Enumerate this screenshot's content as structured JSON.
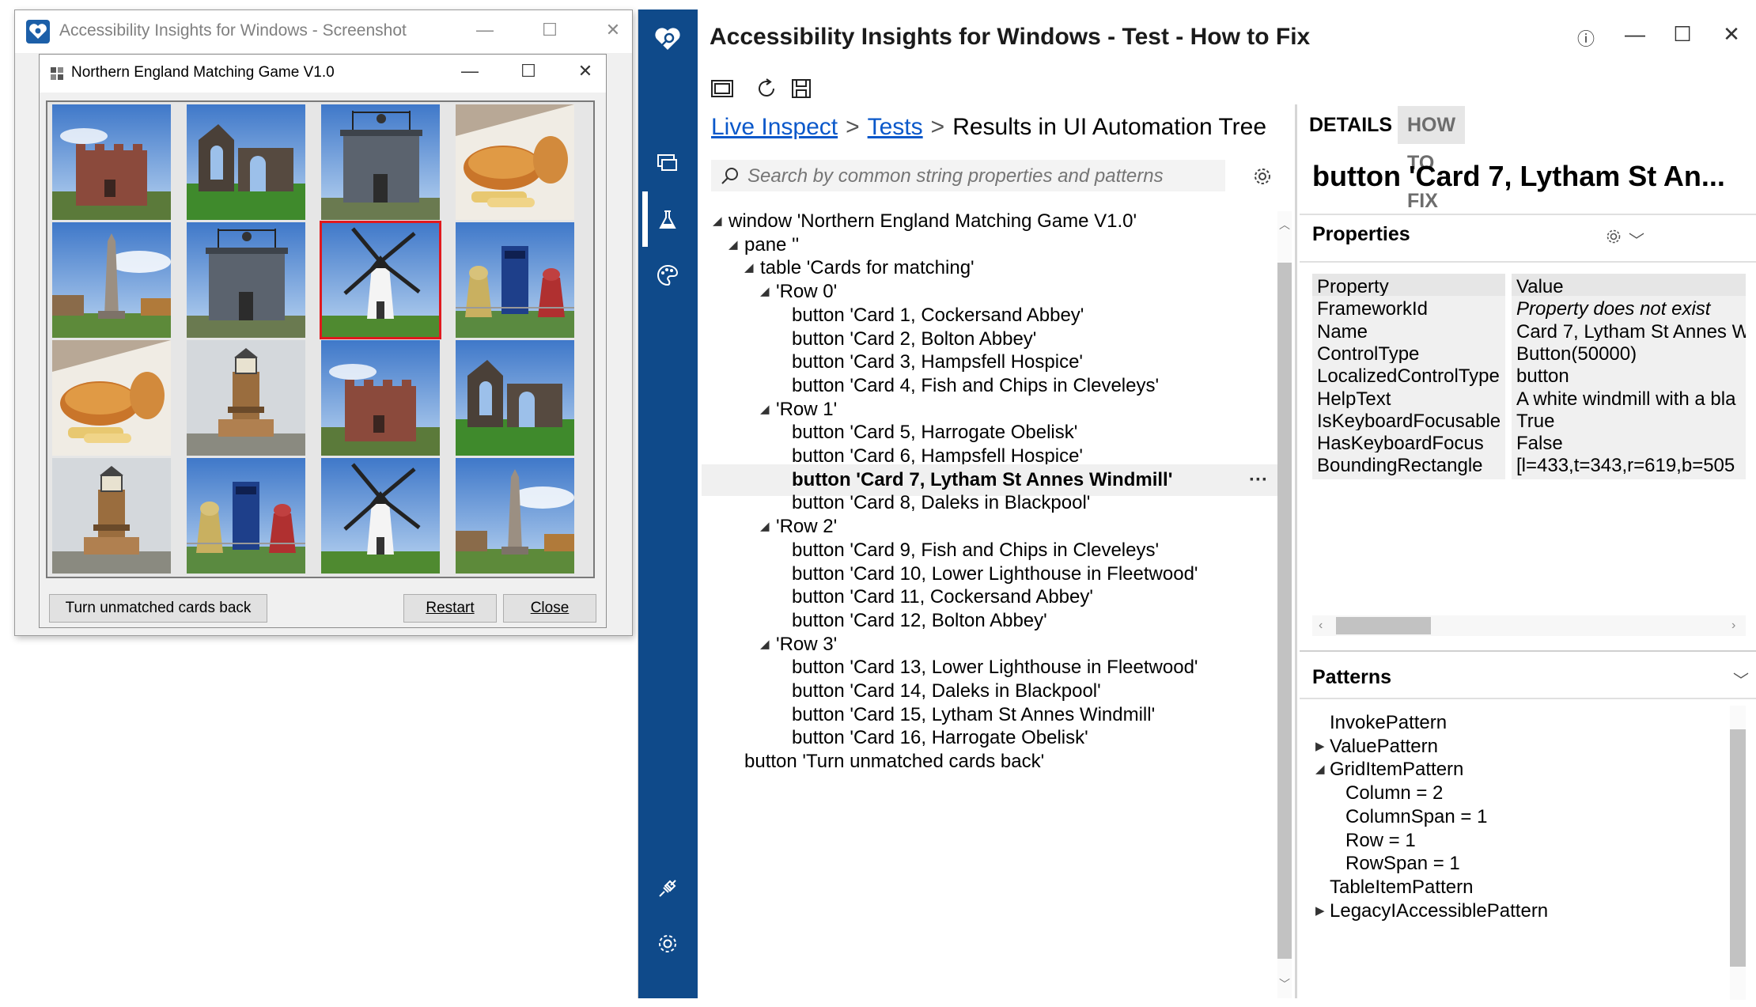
{
  "outer_window": {
    "title": "Accessibility Insights for Windows - Screenshot"
  },
  "game_window": {
    "title": "Northern England Matching Game V1.0",
    "cards": [
      {
        "subject": "fort"
      },
      {
        "subject": "abbey-ruin"
      },
      {
        "subject": "stone-tower"
      },
      {
        "subject": "fish-and-chips"
      },
      {
        "subject": "obelisk"
      },
      {
        "subject": "stone-tower"
      },
      {
        "subject": "windmill",
        "selected": true
      },
      {
        "subject": "daleks"
      },
      {
        "subject": "fish-and-chips"
      },
      {
        "subject": "lighthouse"
      },
      {
        "subject": "fort"
      },
      {
        "subject": "abbey-ruin"
      },
      {
        "subject": "lighthouse"
      },
      {
        "subject": "daleks"
      },
      {
        "subject": "windmill"
      },
      {
        "subject": "obelisk"
      }
    ],
    "buttons": {
      "turn_unmatched": "Turn unmatched cards back",
      "restart": "Restart",
      "close": "Close"
    }
  },
  "ai": {
    "title": "Accessibility Insights for Windows - Test - How to Fix",
    "breadcrumb": {
      "link1": "Live Inspect",
      "link2": "Tests",
      "current": "Results in UI Automation Tree"
    },
    "search": {
      "placeholder": "Search by common string properties and patterns"
    },
    "tree": [
      {
        "text": "window 'Northern England Matching Game V1.0'",
        "exp": "◢"
      },
      {
        "text": "pane ''",
        "exp": "◢"
      },
      {
        "text": "table 'Cards for matching'",
        "exp": "◢"
      },
      {
        "text": "'Row 0'",
        "exp": "◢"
      },
      {
        "text": "button 'Card 1, Cockersand Abbey'",
        "exp": ""
      },
      {
        "text": "button 'Card 2, Bolton Abbey'",
        "exp": ""
      },
      {
        "text": "button 'Card 3, Hampsfell Hospice'",
        "exp": ""
      },
      {
        "text": "button 'Card 4, Fish and Chips in Cleveleys'",
        "exp": ""
      },
      {
        "text": "'Row 1'",
        "exp": "◢"
      },
      {
        "text": "button 'Card 5, Harrogate Obelisk'",
        "exp": ""
      },
      {
        "text": "button 'Card 6, Hampsfell Hospice'",
        "exp": ""
      },
      {
        "text": "button 'Card 7, Lytham St Annes Windmill'",
        "exp": "",
        "selected": true
      },
      {
        "text": "button 'Card 8, Daleks in Blackpool'",
        "exp": ""
      },
      {
        "text": "'Row 2'",
        "exp": "◢"
      },
      {
        "text": "button 'Card 9, Fish and Chips in Cleveleys'",
        "exp": ""
      },
      {
        "text": "button 'Card 10, Lower Lighthouse in Fleetwood'",
        "exp": ""
      },
      {
        "text": "button 'Card 11, Cockersand Abbey'",
        "exp": ""
      },
      {
        "text": "button 'Card 12, Bolton Abbey'",
        "exp": ""
      },
      {
        "text": "'Row 3'",
        "exp": "◢"
      },
      {
        "text": "button 'Card 13, Lower Lighthouse in Fleetwood'",
        "exp": ""
      },
      {
        "text": "button 'Card 14, Daleks in Blackpool'",
        "exp": ""
      },
      {
        "text": "button 'Card 15, Lytham St Annes Windmill'",
        "exp": ""
      },
      {
        "text": "button 'Card 16, Harrogate Obelisk'",
        "exp": ""
      },
      {
        "text": "button 'Turn unmatched cards back'",
        "exp": ""
      }
    ],
    "tree_more": "···",
    "tabs": {
      "details": "DETAILS",
      "how_to_fix": "HOW TO FIX"
    },
    "element_title": "button 'Card 7, Lytham St An...",
    "properties_header": "Properties",
    "properties": {
      "head_key": "Property",
      "head_value": "Value",
      "rows": [
        {
          "key": "FrameworkId",
          "value": "Property does not exist",
          "italic": true
        },
        {
          "key": "Name",
          "value": "Card 7, Lytham St Annes W"
        },
        {
          "key": "ControlType",
          "value": "Button(50000)"
        },
        {
          "key": "LocalizedControlType",
          "value": "button"
        },
        {
          "key": "HelpText",
          "value": "A white windmill with a bla"
        },
        {
          "key": "IsKeyboardFocusable",
          "value": "True"
        },
        {
          "key": "HasKeyboardFocus",
          "value": "False"
        },
        {
          "key": "BoundingRectangle",
          "value": "[l=433,t=343,r=619,b=505"
        }
      ]
    },
    "patterns_header": "Patterns",
    "patterns": [
      {
        "text": "InvokePattern",
        "exp": ""
      },
      {
        "text": "ValuePattern",
        "exp": "▶"
      },
      {
        "text": "GridItemPattern",
        "exp": "◢"
      },
      {
        "text": "Column = 2",
        "exp": ""
      },
      {
        "text": "ColumnSpan = 1",
        "exp": ""
      },
      {
        "text": "Row = 1",
        "exp": ""
      },
      {
        "text": "RowSpan = 1",
        "exp": ""
      },
      {
        "text": "TableItemPattern",
        "exp": ""
      },
      {
        "text": "LegacyIAccessiblePattern",
        "exp": "▶"
      }
    ]
  },
  "colors": {
    "sidebar": "#0f4a8a",
    "link": "#0a58ca",
    "selected_card_border": "#e0191e"
  }
}
